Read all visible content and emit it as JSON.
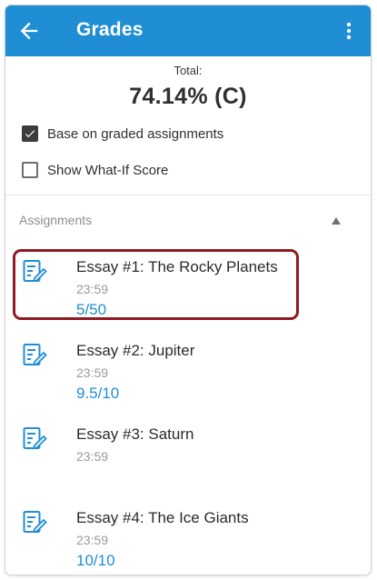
{
  "header": {
    "title": "Grades",
    "back_icon": "arrow-back-icon",
    "overflow_icon": "more-vertical-icon",
    "background_color": "#1f8ed4"
  },
  "summary": {
    "total_label": "Total:",
    "total_value": "74.14% (C)"
  },
  "options": [
    {
      "label": "Base on graded assignments",
      "checked": true
    },
    {
      "label": "Show What-If Score",
      "checked": false
    }
  ],
  "assignments_section": {
    "header": "Assignments",
    "collapse_icon": "triangle-up-icon",
    "items": [
      {
        "name": "Essay #1: The Rocky Planets",
        "due": "23:59",
        "score": "5/50",
        "highlighted": true
      },
      {
        "name": "Essay #2: Jupiter",
        "due": "23:59",
        "score": "9.5/10"
      },
      {
        "name": "Essay #3: Saturn",
        "due": "23:59",
        "score": ""
      },
      {
        "name": "Essay #4: The Ice Giants",
        "due": "23:59",
        "score": "10/10"
      }
    ]
  },
  "colors": {
    "accent": "#1f8ed4",
    "highlight_border": "#8e1b23"
  }
}
